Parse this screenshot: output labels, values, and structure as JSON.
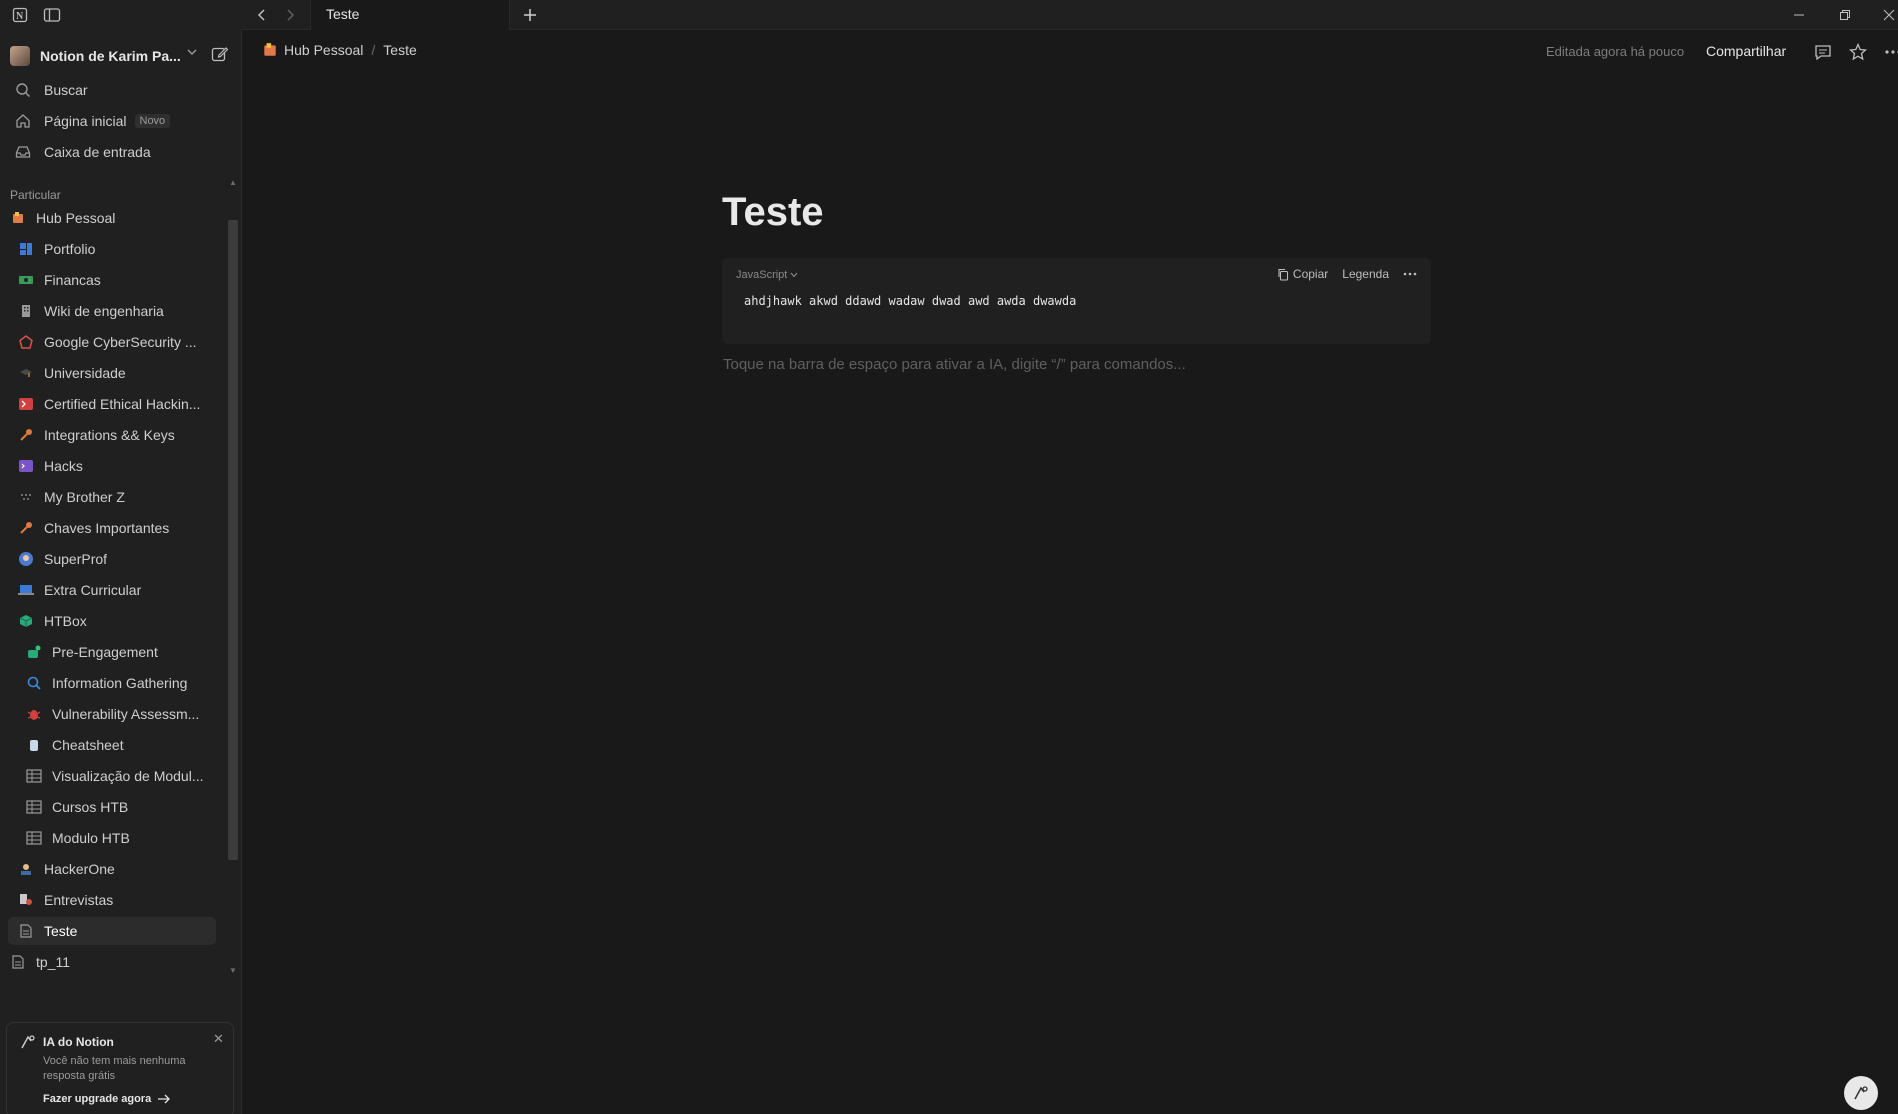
{
  "titlebar": {
    "tab_title": "Teste"
  },
  "sidebar": {
    "workspace_name": "Notion de Karim Pa...",
    "nav": [
      {
        "label": "Buscar"
      },
      {
        "label": "Página inicial",
        "badge": "Novo"
      },
      {
        "label": "Caixa de entrada"
      }
    ],
    "section_label": "Particular",
    "pages": [
      {
        "label": "Hub Pessoal",
        "icon": "hub-icon"
      },
      {
        "label": "Portfolio",
        "icon": "portfolio-icon"
      },
      {
        "label": "Financas",
        "icon": "money-icon"
      },
      {
        "label": "Wiki de engenharia",
        "icon": "building-icon"
      },
      {
        "label": "Google CyberSecurity ...",
        "icon": "pentagon-icon"
      },
      {
        "label": "Universidade",
        "icon": "graduation-icon"
      },
      {
        "label": "Certified Ethical Hackin...",
        "icon": "terminal-icon"
      },
      {
        "label": "Integrations && Keys",
        "icon": "key-icon"
      },
      {
        "label": "Hacks",
        "icon": "code-icon"
      },
      {
        "label": "My Brother Z",
        "icon": "dots-icon"
      },
      {
        "label": "Chaves Importantes",
        "icon": "key-icon"
      },
      {
        "label": "SuperProf",
        "icon": "globe-icon"
      },
      {
        "label": "Extra Curricular",
        "icon": "laptop-icon"
      },
      {
        "label": "HTBox",
        "icon": "box-icon"
      },
      {
        "label": "Pre-Engagement",
        "icon": "people-icon"
      },
      {
        "label": "Information Gathering",
        "icon": "search-icon"
      },
      {
        "label": "Vulnerability Assessm...",
        "icon": "bug-icon"
      },
      {
        "label": "Cheatsheet",
        "icon": "database-icon"
      },
      {
        "label": "Visualização de Modul...",
        "icon": "table-icon"
      },
      {
        "label": "Cursos HTB",
        "icon": "table-icon"
      },
      {
        "label": "Modulo HTB",
        "icon": "table-icon"
      },
      {
        "label": "HackerOne",
        "icon": "hacker-icon"
      },
      {
        "label": "Entrevistas",
        "icon": "interview-icon"
      },
      {
        "label": "Teste",
        "icon": "page-icon",
        "selected": true
      },
      {
        "label": "tp_11",
        "icon": "page-icon"
      }
    ],
    "ai_card": {
      "title": "IA do Notion",
      "body": "Você não tem mais nenhuma resposta grátis",
      "link": "Fazer upgrade agora"
    }
  },
  "topbar": {
    "breadcrumb": [
      "Hub Pessoal",
      "Teste"
    ],
    "edited": "Editada agora há pouco",
    "share": "Compartilhar"
  },
  "document": {
    "title": "Teste",
    "code_block": {
      "language": "JavaScript",
      "copy_label": "Copiar",
      "caption_label": "Legenda",
      "code": "ahdjhawk akwd ddawd wadaw dwad awd awda dwawda"
    },
    "placeholder": "Toque na barra de espaço para ativar a IA, digite “/” para comandos..."
  },
  "colors": {
    "background": "#191919",
    "sidebar": "#202020",
    "text": "#d4d4d4"
  }
}
